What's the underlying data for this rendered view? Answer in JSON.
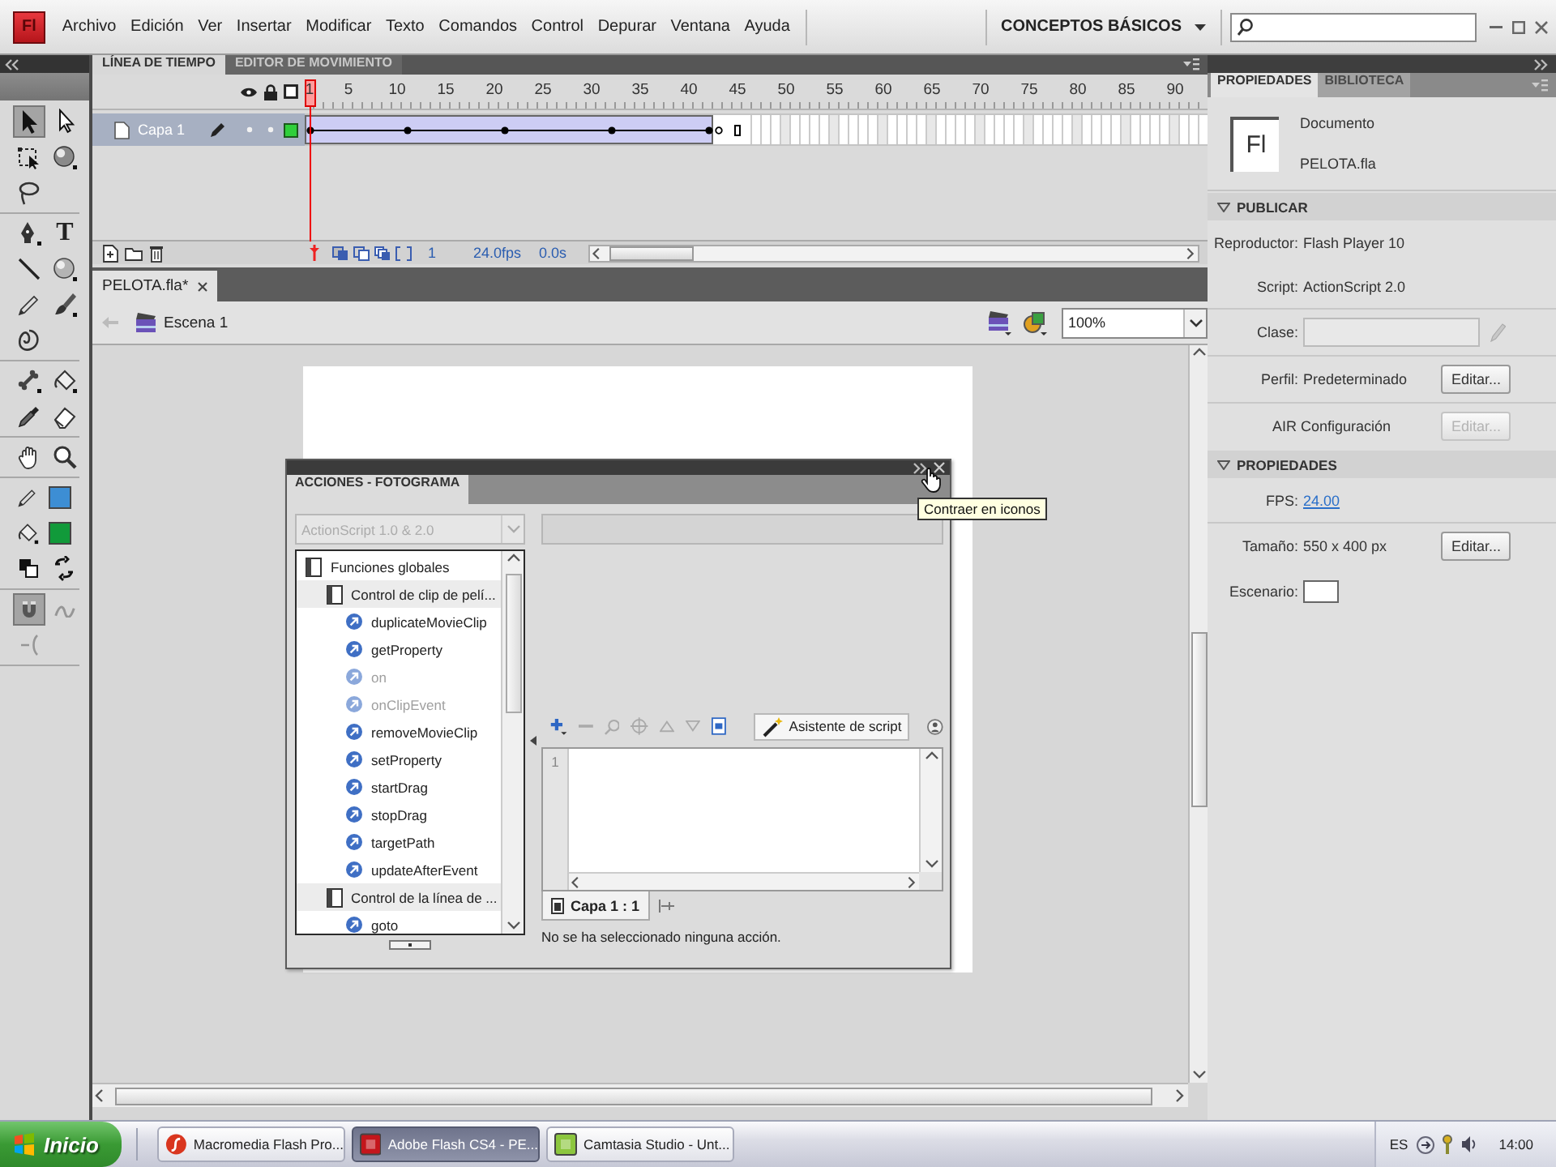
{
  "logo": {
    "text": "Fl"
  },
  "menu": [
    "Archivo",
    "Edición",
    "Ver",
    "Insertar",
    "Modificar",
    "Texto",
    "Comandos",
    "Control",
    "Depurar",
    "Ventana",
    "Ayuda"
  ],
  "workspace": {
    "label": "CONCEPTOS BÁSICOS"
  },
  "toolbar": {
    "groups": [
      {
        "tools": [
          {
            "kind": "selection",
            "selected": true
          },
          {
            "kind": "subselection",
            "selected": false
          },
          {
            "kind": "transform",
            "selected": false
          },
          {
            "kind": "rotation",
            "selected": false
          },
          {
            "kind": "lasso",
            "selected": false
          }
        ]
      },
      {
        "tools": [
          {
            "kind": "pen",
            "selected": false
          },
          {
            "kind": "text",
            "label": "T",
            "selected": false
          },
          {
            "kind": "line",
            "selected": false
          },
          {
            "kind": "oval",
            "selected": false
          },
          {
            "kind": "pencil",
            "selected": false
          },
          {
            "kind": "brush",
            "selected": false
          },
          {
            "kind": "deco",
            "selected": false
          }
        ]
      },
      {
        "tools": [
          {
            "kind": "bone",
            "selected": false
          },
          {
            "kind": "bucket",
            "selected": false
          },
          {
            "kind": "eyedropper",
            "selected": false
          },
          {
            "kind": "eraser",
            "selected": false
          }
        ]
      },
      {
        "tools": [
          {
            "kind": "hand",
            "selected": false
          },
          {
            "kind": "zoom",
            "selected": false
          }
        ]
      },
      {
        "tools": [
          {
            "kind": "stroke",
            "color": "#3d8ed4"
          },
          {
            "kind": "fill",
            "color": "#119a3a"
          },
          {
            "kind": "defaults"
          },
          {
            "kind": "swap"
          }
        ]
      },
      {
        "tools": [
          {
            "kind": "snap",
            "selected": true,
            "disabled": false
          },
          {
            "kind": "smooth",
            "selected": false,
            "disabled": true
          },
          {
            "kind": "straighten",
            "selected": false,
            "disabled": true
          }
        ]
      }
    ]
  },
  "timeline": {
    "tabs": [
      {
        "label": "LÍNEA DE TIEMPO",
        "selected": true
      },
      {
        "label": "EDITOR DE MOVIMIENTO",
        "selected": false
      }
    ],
    "ruler": [
      "1",
      "5",
      "10",
      "15",
      "20",
      "25",
      "30",
      "35",
      "40",
      "45",
      "50",
      "55",
      "60",
      "65",
      "70",
      "75",
      "80",
      "85",
      "90"
    ],
    "layers": [
      {
        "name": "Capa 1",
        "selected": true,
        "color": "#2fcf3a",
        "frames": [
          {
            "kind": "key",
            "playhead": true
          },
          {
            "kind": "tween",
            "playhead": false
          },
          {
            "kind": "tween",
            "playhead": false
          },
          {
            "kind": "tween",
            "playhead": false
          },
          {
            "kind": "tween",
            "playhead": false
          },
          {
            "kind": "tween",
            "playhead": false
          },
          {
            "kind": "tween",
            "playhead": false
          },
          {
            "kind": "tween",
            "playhead": false
          },
          {
            "kind": "tween",
            "playhead": false
          },
          {
            "kind": "tween",
            "playhead": false
          },
          {
            "kind": "key",
            "playhead": false
          },
          {
            "kind": "tween",
            "playhead": false
          },
          {
            "kind": "tween",
            "playhead": false
          },
          {
            "kind": "tween",
            "playhead": false
          },
          {
            "kind": "tween",
            "playhead": false
          },
          {
            "kind": "tween",
            "playhead": false
          },
          {
            "kind": "tween",
            "playhead": false
          },
          {
            "kind": "tween",
            "playhead": false
          },
          {
            "kind": "tween",
            "playhead": false
          },
          {
            "kind": "tween",
            "playhead": false
          },
          {
            "kind": "key",
            "playhead": false
          },
          {
            "kind": "tween",
            "playhead": false
          },
          {
            "kind": "tween",
            "playhead": false
          },
          {
            "kind": "tween",
            "playhead": false
          },
          {
            "kind": "tween",
            "playhead": false
          },
          {
            "kind": "tween",
            "playhead": false
          },
          {
            "kind": "tween",
            "playhead": false
          },
          {
            "kind": "tween",
            "playhead": false
          },
          {
            "kind": "tween",
            "playhead": false
          },
          {
            "kind": "tween",
            "playhead": false
          },
          {
            "kind": "tween",
            "playhead": false
          },
          {
            "kind": "key",
            "playhead": false
          },
          {
            "kind": "tween",
            "playhead": false
          },
          {
            "kind": "tween",
            "playhead": false
          },
          {
            "kind": "tween",
            "playhead": false
          },
          {
            "kind": "tween",
            "playhead": false
          },
          {
            "kind": "tween",
            "playhead": false
          },
          {
            "kind": "tween",
            "playhead": false
          },
          {
            "kind": "tween",
            "playhead": false
          },
          {
            "kind": "tween",
            "playhead": false
          },
          {
            "kind": "tween",
            "playhead": false
          },
          {
            "kind": "key",
            "playhead": false
          },
          {
            "kind": "blank",
            "playhead": false
          },
          {
            "kind": "frame",
            "playhead": false
          },
          {
            "kind": "end",
            "playhead": false
          }
        ]
      }
    ],
    "status": {
      "frame": "1",
      "fps": "24.0fps",
      "time": "0.0s"
    }
  },
  "document_tabs": [
    {
      "label": "PELOTA.fla*",
      "selected": true
    }
  ],
  "edit_bar": {
    "scene": "Escena 1",
    "zoom": "100%"
  },
  "actions_panel": {
    "tabs": [
      {
        "label": "ACCIONES - FOTOGRAMA",
        "selected": true
      }
    ],
    "version": {
      "value": "ActionScript 1.0 & 2.0",
      "disabled": true
    },
    "tree": [
      {
        "label": "Funciones globales",
        "disabled": false,
        "children": [
          {
            "label": "Control de clip de pelí...",
            "disabled": false,
            "children": [
              {
                "label": "duplicateMovieClip",
                "disabled": false
              },
              {
                "label": "getProperty",
                "disabled": false
              },
              {
                "label": "on",
                "disabled": true
              },
              {
                "label": "onClipEvent",
                "disabled": true
              },
              {
                "label": "removeMovieClip",
                "disabled": false
              },
              {
                "label": "setProperty",
                "disabled": false
              },
              {
                "label": "startDrag",
                "disabled": false
              },
              {
                "label": "stopDrag",
                "disabled": false
              },
              {
                "label": "targetPath",
                "disabled": false
              },
              {
                "label": "updateAfterEvent",
                "disabled": false
              }
            ]
          },
          {
            "label": "Control de la línea de ...",
            "disabled": false,
            "children": [
              {
                "label": "goto",
                "disabled": false
              }
            ]
          }
        ]
      }
    ],
    "script_assist": "Asistente de script",
    "line_numbers": [
      "1"
    ],
    "script_tab": "Capa 1 : 1",
    "status": "No se ha seleccionado ninguna acción."
  },
  "tooltip": {
    "text": "Contraer en iconos"
  },
  "properties_panel": {
    "tabs": [
      {
        "label": "PROPIEDADES",
        "selected": true
      },
      {
        "label": "BIBLIOTECA",
        "selected": false
      }
    ],
    "document": {
      "icon_label": "Fl",
      "type": "Documento",
      "file": "PELOTA.fla"
    },
    "sections": [
      {
        "title": "PUBLICAR",
        "expanded": true,
        "rows": [
          {
            "kind": "text",
            "label": "Reproductor:",
            "value": "Flash Player 10"
          },
          {
            "kind": "text",
            "label": "Script:",
            "value": "ActionScript 2.0"
          },
          {
            "kind": "field",
            "label": "Clase:"
          },
          {
            "kind": "button",
            "label": "Perfil:",
            "value": "Predeterminado",
            "button": "Editar...",
            "disabled": false
          },
          {
            "kind": "button",
            "label": "AIR Configuración",
            "button": "Editar...",
            "disabled": true
          }
        ]
      },
      {
        "title": "PROPIEDADES",
        "expanded": true,
        "rows": [
          {
            "kind": "link",
            "label": "FPS:",
            "value": "24.00"
          },
          {
            "kind": "button",
            "label": "Tamaño:",
            "value": "550 x 400 px",
            "button": "Editar...",
            "disabled": false
          },
          {
            "kind": "swatch",
            "label": "Escenario:",
            "color": "#ffffff"
          }
        ]
      }
    ]
  },
  "taskbar": {
    "start": "Inicio",
    "tasks": [
      {
        "label": "Macromedia Flash Pro...",
        "kind": "disc",
        "color": "#d9361f",
        "selected": false
      },
      {
        "label": "Adobe Flash CS4 - PE...",
        "kind": "tile",
        "color": "#c4161c",
        "selected": true
      },
      {
        "label": "Camtasia Studio - Unt...",
        "kind": "tile",
        "color": "#8cc63e",
        "selected": false
      }
    ],
    "language": "ES",
    "clock": "14:00"
  }
}
